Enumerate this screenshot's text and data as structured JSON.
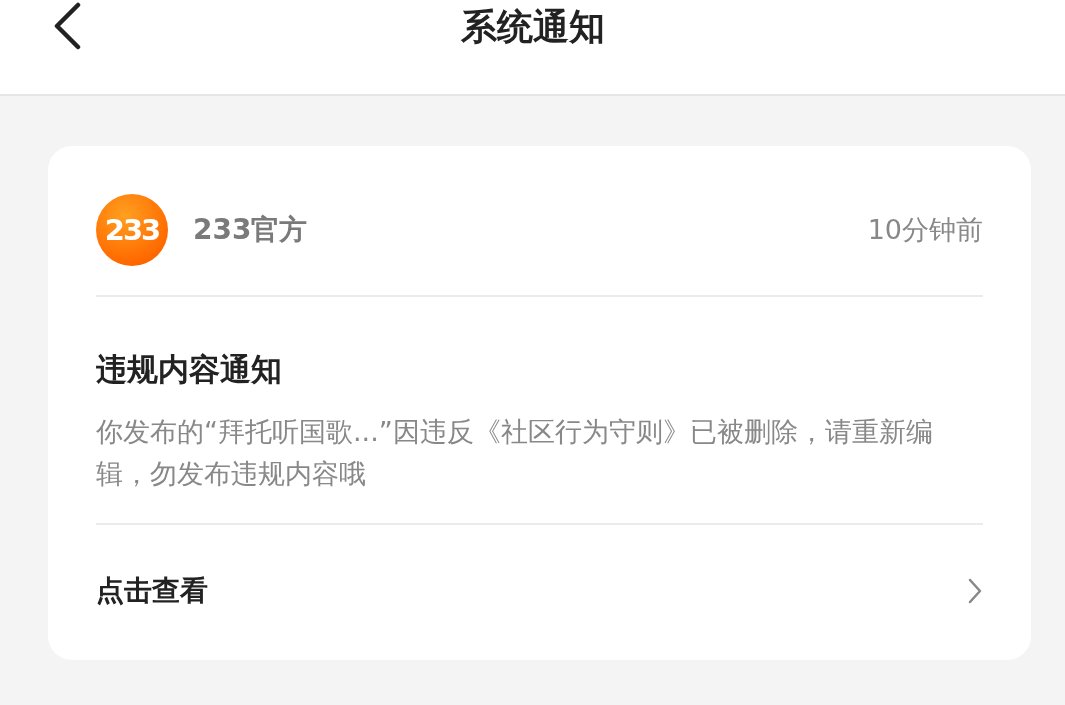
{
  "header": {
    "title": "系统通知"
  },
  "notice": {
    "sender": {
      "logo_text": "233",
      "name": "233官方"
    },
    "time": "10分钟前",
    "title": "违规内容通知",
    "body": "你发布的“拜托听国歌...”因违反《社区行为守则》已被删除，请重新编辑，勿发布违规内容哦",
    "action": "点击查看"
  }
}
